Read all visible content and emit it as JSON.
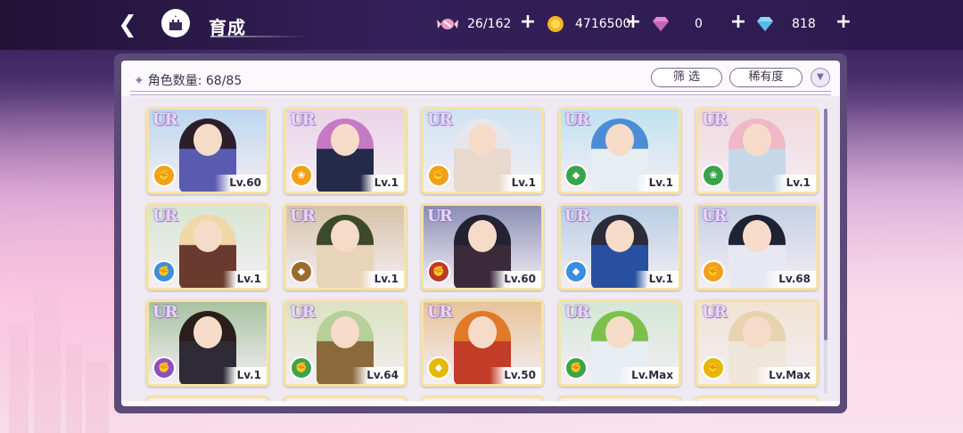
{
  "header": {
    "title": "育成",
    "resources": [
      {
        "icon": "candy-icon",
        "value": "26/162"
      },
      {
        "icon": "gold-coin-icon",
        "value": "4716500"
      },
      {
        "icon": "pink-diamond-icon",
        "value": "0"
      },
      {
        "icon": "blue-diamond-icon",
        "value": "818"
      }
    ]
  },
  "panel": {
    "count_label": "角色数量: 68/85",
    "filter_label": "筛 选",
    "rarity_label": "稀有度"
  },
  "colors": {
    "gold": "#f6e3a3",
    "panel_frame": "#5b4a78"
  },
  "characters": [
    {
      "rarity": "UR",
      "level": "Lv.60",
      "attr_color": "#f2a01c",
      "attr_icon": "fist-icon"
    },
    {
      "rarity": "UR",
      "level": "Lv.1",
      "attr_color": "#f2a01c",
      "attr_icon": "rattle-icon"
    },
    {
      "rarity": "UR",
      "level": "Lv.1",
      "attr_color": "#f2a01c",
      "attr_icon": "fist-icon"
    },
    {
      "rarity": "UR",
      "level": "Lv.1",
      "attr_color": "#38a44c",
      "attr_icon": "shield-icon"
    },
    {
      "rarity": "UR",
      "level": "Lv.1",
      "attr_color": "#38a44c",
      "attr_icon": "rattle-icon"
    },
    {
      "rarity": "UR",
      "level": "Lv.1",
      "attr_color": "#3a8ee0",
      "attr_icon": "fist-icon"
    },
    {
      "rarity": "UR",
      "level": "Lv.1",
      "attr_color": "#9b6a2e",
      "attr_icon": "shield-icon"
    },
    {
      "rarity": "UR",
      "level": "Lv.60",
      "attr_color": "#c0392b",
      "attr_icon": "fist-icon"
    },
    {
      "rarity": "UR",
      "level": "Lv.1",
      "attr_color": "#3a8ee0",
      "attr_icon": "shield-icon"
    },
    {
      "rarity": "UR",
      "level": "Lv.68",
      "attr_color": "#f2a01c",
      "attr_icon": "fist-icon"
    },
    {
      "rarity": "UR",
      "level": "Lv.1",
      "attr_color": "#8e4fc0",
      "attr_icon": "fist-icon"
    },
    {
      "rarity": "UR",
      "level": "Lv.64",
      "attr_color": "#38a44c",
      "attr_icon": "fist-icon"
    },
    {
      "rarity": "UR",
      "level": "Lv.50",
      "attr_color": "#e6b800",
      "attr_icon": "shield-icon"
    },
    {
      "rarity": "UR",
      "level": "Lv.Max",
      "attr_color": "#38a44c",
      "attr_icon": "fist-icon"
    },
    {
      "rarity": "UR",
      "level": "Lv.Max",
      "attr_color": "#e6b800",
      "attr_icon": "fist-icon"
    }
  ]
}
